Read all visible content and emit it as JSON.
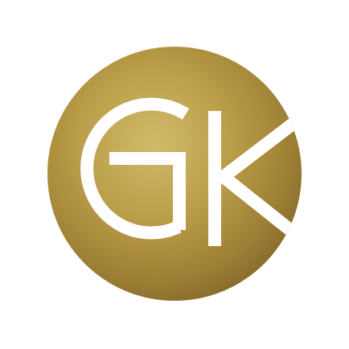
{
  "logo": {
    "monogram_text": "GK",
    "colors": {
      "background": "#ffffff",
      "gold_light": "#d8c372",
      "gold_mid": "#b89a45",
      "gold_dark": "#8c7030",
      "letter": "#ffffff"
    }
  }
}
